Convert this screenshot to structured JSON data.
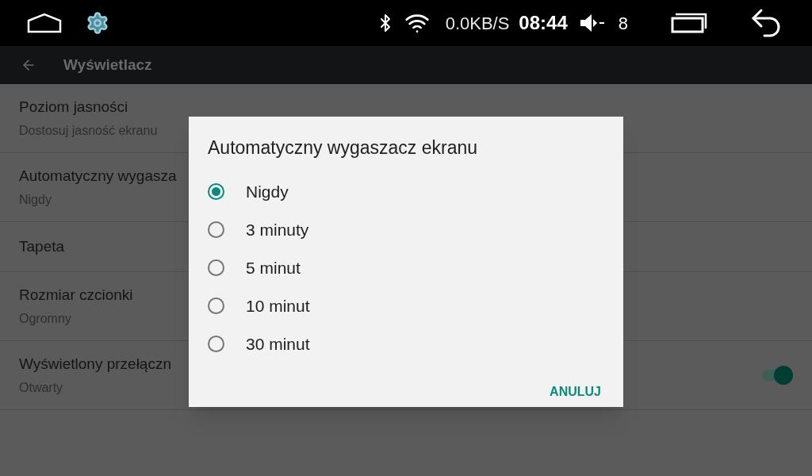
{
  "status_bar": {
    "network_speed": "0.0KB/S",
    "time": "08:44",
    "volume": "8"
  },
  "toolbar": {
    "title": "Wyświetlacz"
  },
  "settings": [
    {
      "kind": "text",
      "title": "Poziom jasności",
      "subtitle": "Dostosuj jasność ekranu"
    },
    {
      "kind": "text",
      "title": "Automatyczny wygasza",
      "subtitle": "Nigdy"
    },
    {
      "kind": "text",
      "title": "Tapeta"
    },
    {
      "kind": "text",
      "title": "Rozmiar czcionki",
      "subtitle": "Ogromny"
    },
    {
      "kind": "toggle",
      "title": "Wyświetlony przełączn",
      "subtitle": "Otwarty",
      "on": true
    }
  ],
  "dialog": {
    "title": "Automatyczny wygaszacz ekranu",
    "options": [
      {
        "label": "Nigdy",
        "selected": true
      },
      {
        "label": "3 minuty",
        "selected": false
      },
      {
        "label": "5 minut",
        "selected": false
      },
      {
        "label": "10 minut",
        "selected": false
      },
      {
        "label": "30 minut",
        "selected": false
      }
    ],
    "buttons": [
      "ANULUJ"
    ]
  }
}
